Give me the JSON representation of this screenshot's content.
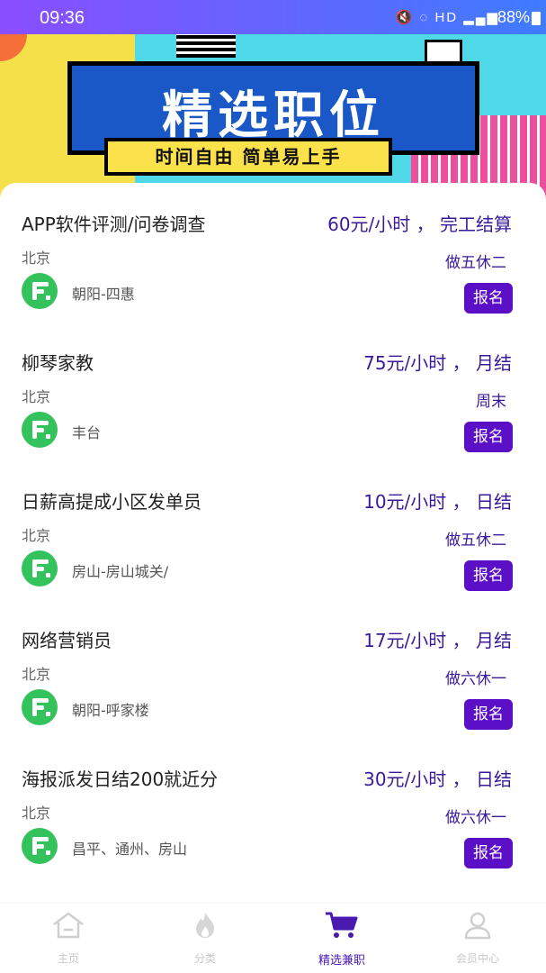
{
  "status_bar": {
    "time": "09:36",
    "icons": "🔇 ◌ HD ▂▄▆",
    "battery": "88%"
  },
  "banner": {
    "title": "精选职位",
    "subtitle": "时间自由 简单易上手"
  },
  "jobs": [
    {
      "title": "APP软件评测/问卷调查",
      "pay": "60元/小时 ， 完工结算",
      "city": "北京",
      "schedule": "做五休二",
      "area": "朝阳-四惠",
      "button": "报名"
    },
    {
      "title": "柳琴家教",
      "pay": "75元/小时 ， 月结",
      "city": "北京",
      "schedule": "周末",
      "area": "丰台",
      "button": "报名"
    },
    {
      "title": "日薪高提成小区发单员",
      "pay": "10元/小时 ， 日结",
      "city": "北京",
      "schedule": "做五休二",
      "area": "房山-房山城关/",
      "button": "报名"
    },
    {
      "title": "网络营销员",
      "pay": "17元/小时 ， 月结",
      "city": "北京",
      "schedule": "做六休一",
      "area": "朝阳-呼家楼",
      "button": "报名"
    },
    {
      "title": "海报派发日结200就近分",
      "pay": "30元/小时 ， 日结",
      "city": "北京",
      "schedule": "做六休一",
      "area": "昌平、通州、房山",
      "button": "报名"
    }
  ],
  "bottom_nav": {
    "items": [
      {
        "label": "主页",
        "icon": "home-icon"
      },
      {
        "label": "分类",
        "icon": "fire-icon"
      },
      {
        "label": "精选兼职",
        "icon": "cart-icon"
      },
      {
        "label": "会员中心",
        "icon": "user-icon"
      }
    ],
    "active_index": 2
  },
  "colors": {
    "accent": "#5b10c8",
    "pay_text": "#3a1a9a",
    "logo_green": "#33c25b"
  }
}
